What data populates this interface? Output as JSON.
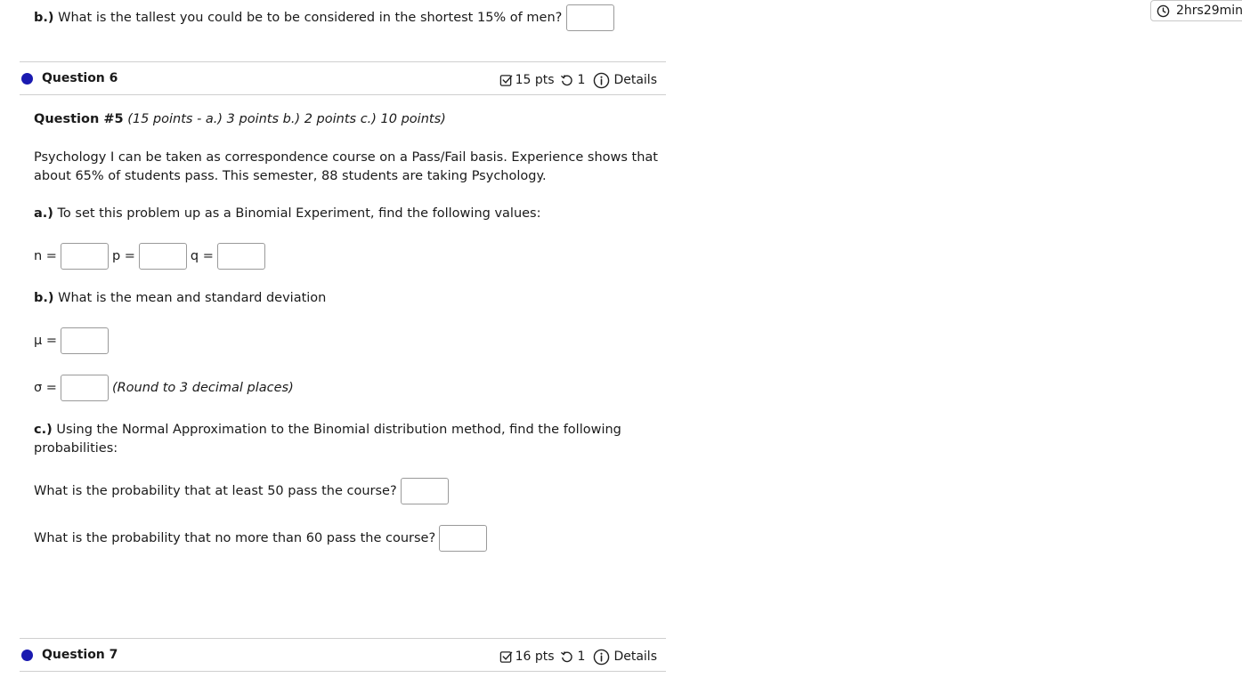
{
  "previous_question": {
    "part_label": "b.)",
    "prompt": "What is the tallest you could be to be considered in the shortest 15% of men?",
    "answer": ""
  },
  "timer": {
    "icon": "clock-icon",
    "text": "2hrs29mins"
  },
  "question6": {
    "title": "Question 6",
    "points": "15 pts",
    "attempts": "1",
    "details_label": "Details",
    "heading_bold": "Question #5",
    "heading_italic": "(15 points - a.) 3 points b.) 2 points c.) 10 points)",
    "intro_line1": "Psychology I can be taken as correspondence course on a Pass/Fail basis. Experience shows that",
    "intro_line2": "about 65% of students pass. This semester, 88 students are taking Psychology.",
    "part_a_label": "a.)",
    "part_a_text": "To set this problem up as a Binomial Experiment, find the following values:",
    "n_label": "n =",
    "p_label": "p =",
    "q_label": "q =",
    "n_value": "",
    "p_value": "",
    "q_value": "",
    "part_b_label": "b.)",
    "part_b_text": "What is the mean and standard deviation",
    "mu_label": "μ =",
    "sigma_label": "σ =",
    "mu_value": "",
    "sigma_value": "",
    "round_note": "(Round to 3 decimal places)",
    "part_c_label": "c.)",
    "part_c_line1": "Using the Normal Approximation to the Binomial distribution method, find the following",
    "part_c_line2": "probabilities:",
    "prob1_text": "What is the probability that at least 50 pass the course?",
    "prob1_value": "",
    "prob2_text": "What is the probability that no more than 60 pass the course?",
    "prob2_value": ""
  },
  "question7": {
    "title": "Question 7",
    "points": "16 pts",
    "attempts": "1",
    "details_label": "Details"
  }
}
